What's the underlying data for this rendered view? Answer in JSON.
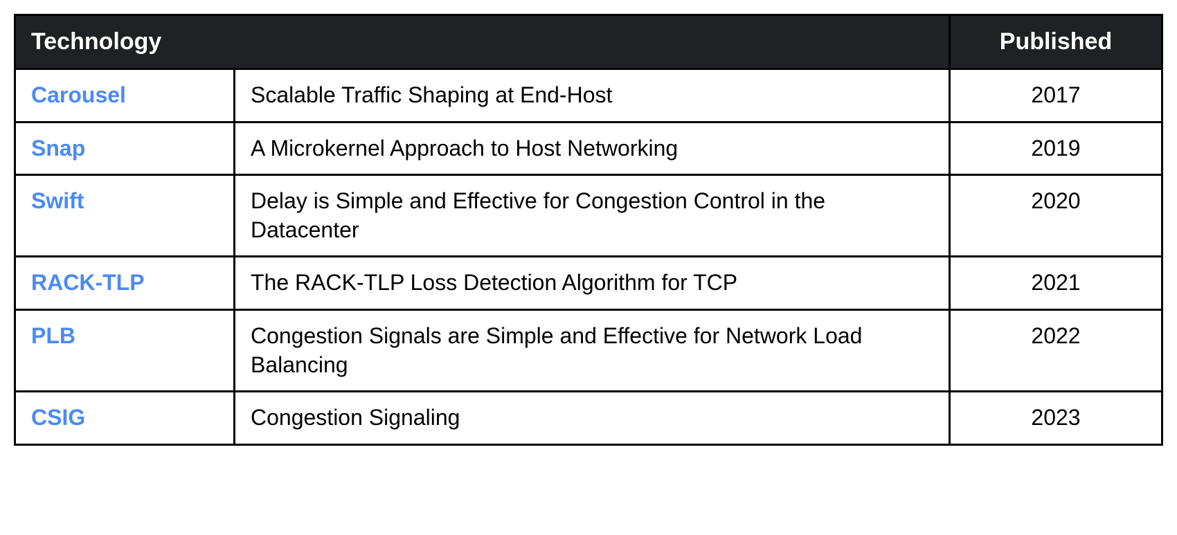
{
  "headers": {
    "technology": "Technology",
    "published": "Published"
  },
  "rows": [
    {
      "name": "Carousel",
      "description": "Scalable Traffic Shaping at End-Host",
      "published": "2017"
    },
    {
      "name": "Snap",
      "description": "A Microkernel Approach to Host Networking",
      "published": "2019"
    },
    {
      "name": "Swift",
      "description": "Delay is Simple and Effective for Congestion Control in the Datacenter",
      "published": "2020"
    },
    {
      "name": "RACK-TLP",
      "description": "The RACK-TLP Loss Detection Algorithm for TCP",
      "published": "2021"
    },
    {
      "name": "PLB",
      "description": "Congestion Signals are Simple and Effective for Network Load Balancing",
      "published": "2022"
    },
    {
      "name": "CSIG",
      "description": "Congestion Signaling",
      "published": "2023"
    }
  ]
}
